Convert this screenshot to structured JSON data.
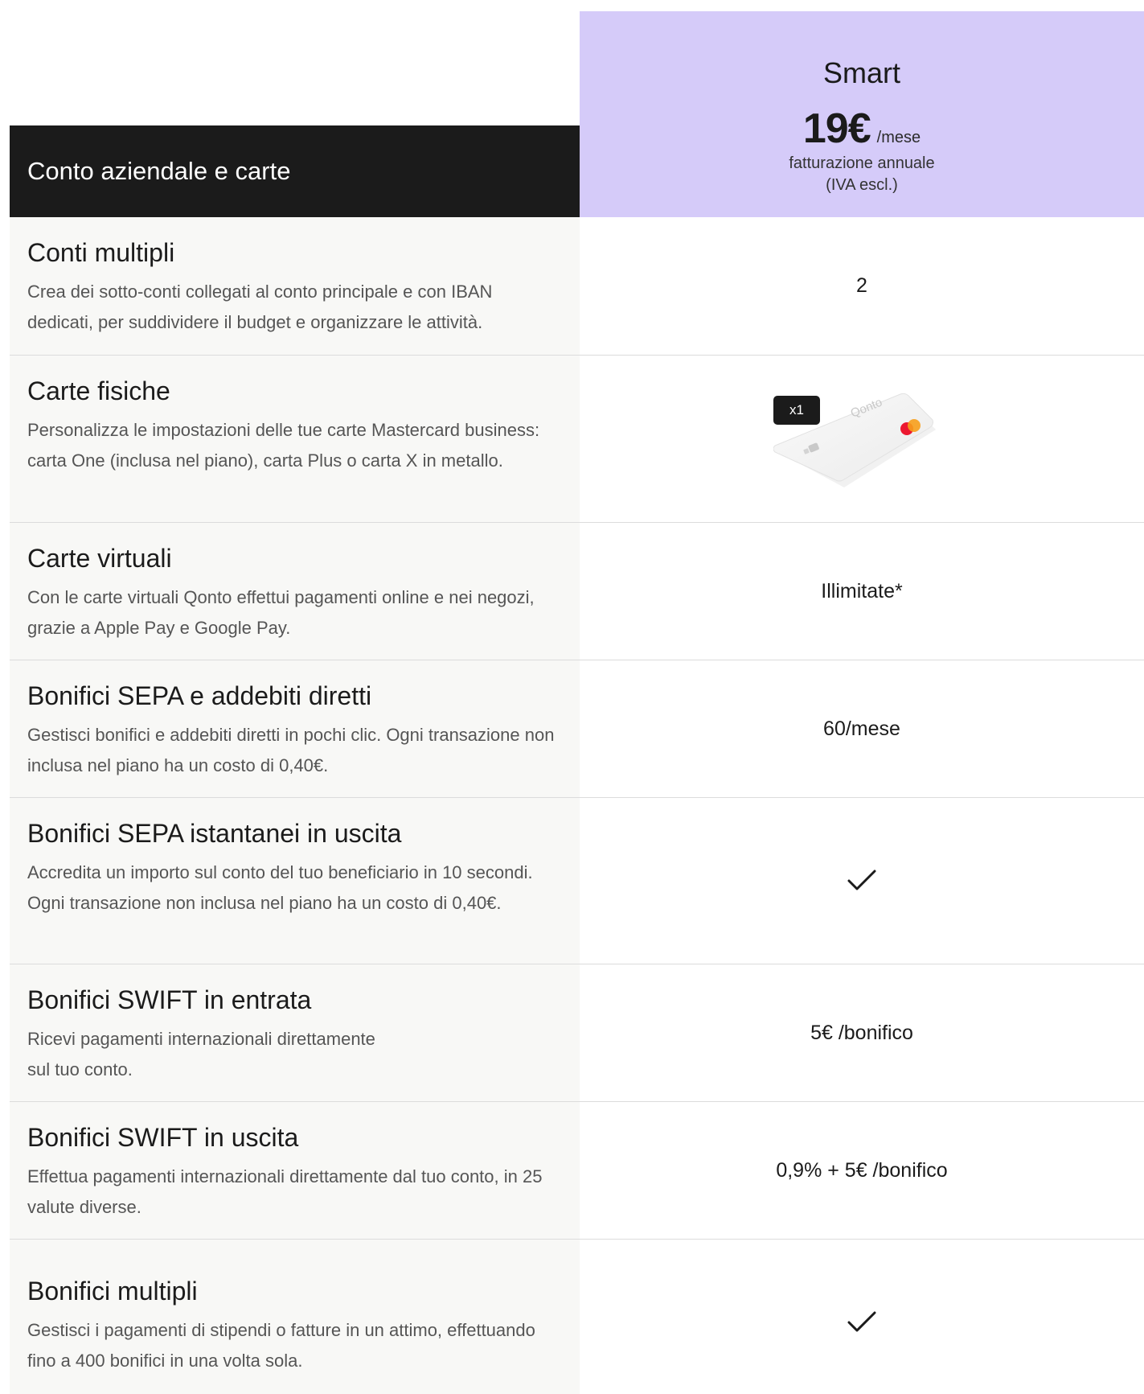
{
  "plan": {
    "name": "Smart",
    "price": "19€",
    "period": "/mese",
    "billing": "fatturazione annuale",
    "vat": "(IVA escl.)"
  },
  "section": {
    "title": "Conto aziendale e carte"
  },
  "features": [
    {
      "title": "Conti multipli",
      "description": "Crea dei sotto-conti collegati al conto principale e con IBAN dedicati, per suddividere il budget e organizzare le attività.",
      "value": "2"
    },
    {
      "title": "Carte fisiche",
      "description": "Personalizza le impostazioni delle tue carte Mastercard business: carta One (inclusa nel piano), carta Plus o carta X in metallo.",
      "badge": "x1",
      "card_brand": "Qonto",
      "icon": "card-image"
    },
    {
      "title": "Carte virtuali",
      "description": "Con le carte virtuali Qonto effettui pagamenti online e nei negozi, grazie a Apple Pay e Google Pay.",
      "value": "Illimitate*"
    },
    {
      "title": "Bonifici SEPA e addebiti diretti",
      "description": "Gestisci bonifici e addebiti diretti in pochi clic. Ogni transazione non inclusa nel piano ha un costo di 0,40€.",
      "value": "60/mese"
    },
    {
      "title": "Bonifici SEPA istantanei in uscita",
      "description": "Accredita un importo sul conto del tuo beneficiario in 10 secondi. Ogni transazione non inclusa nel piano ha un costo di 0,40€.",
      "icon": "check-icon"
    },
    {
      "title": "Bonifici SWIFT in entrata",
      "description_line1": "Ricevi pagamenti internazionali direttamente",
      "description_line2": "sul tuo conto.",
      "value": "5€ /bonifico"
    },
    {
      "title": "Bonifici SWIFT in uscita",
      "description": "Effettua pagamenti internazionali direttamente dal tuo conto, in 25 valute diverse.",
      "value": "0,9% + 5€ /bonifico"
    },
    {
      "title": "Bonifici multipli",
      "description": "Gestisci i pagamenti di stipendi o fatture in un attimo, effettuando fino a 400 bonifici in una volta sola.",
      "icon": "check-icon"
    }
  ],
  "colors": {
    "plan_bg": "#d5cbf9",
    "header_bg": "#1b1b1b",
    "row_bg": "#f8f8f6",
    "divider": "#dcdcdc",
    "mastercard_red": "#eb001b",
    "mastercard_orange": "#f79e1b"
  }
}
